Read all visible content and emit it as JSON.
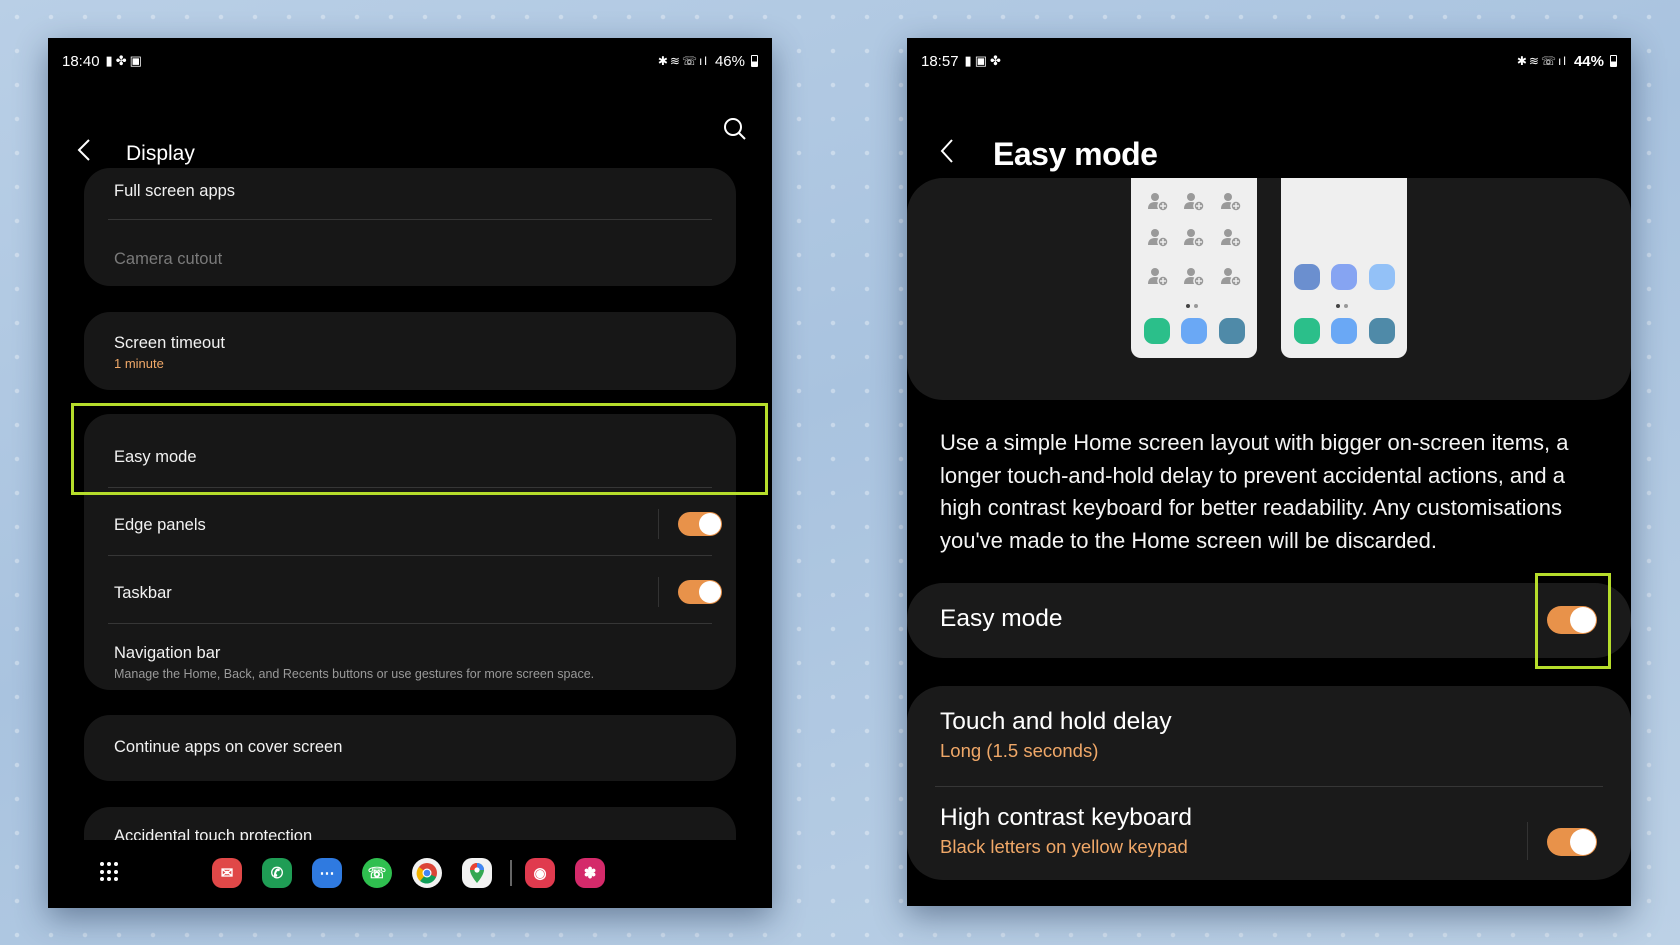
{
  "left_screen": {
    "status_bar": {
      "time": "18:40",
      "notification_icons": [
        "phone-icon",
        "fan-icon",
        "image-icon"
      ],
      "system_icons": [
        "bluetooth-icon",
        "wifi-icon",
        "wifi-calling-icon",
        "signal-icon"
      ],
      "battery": "46%"
    },
    "header": {
      "title": "Display",
      "back_icon": "chevron-left-icon",
      "search_icon": "search-icon"
    },
    "groups": [
      {
        "items": [
          {
            "label": "Full screen apps"
          },
          {
            "label": "Camera cutout",
            "disabled": true
          }
        ]
      },
      {
        "items": [
          {
            "label": "Screen timeout",
            "value": "1 minute"
          }
        ]
      },
      {
        "items": [
          {
            "label": "Easy mode",
            "highlighted": true
          },
          {
            "label": "Edge panels",
            "toggle": true
          },
          {
            "label": "Taskbar",
            "toggle": true
          },
          {
            "label": "Navigation bar",
            "description": "Manage the Home, Back, and Recents buttons or use gestures for more screen space."
          }
        ]
      },
      {
        "items": [
          {
            "label": "Continue apps on cover screen"
          }
        ]
      },
      {
        "items": [
          {
            "label": "Accidental touch protection",
            "toggle": true
          }
        ]
      }
    ],
    "dock": {
      "apps": [
        {
          "name": "Email",
          "icon": "email-icon",
          "color": "#e04848"
        },
        {
          "name": "Phone",
          "icon": "phone-icon",
          "color": "#1f9d55"
        },
        {
          "name": "Messages",
          "icon": "messages-icon",
          "color": "#2f7ae0"
        },
        {
          "name": "WhatsApp",
          "icon": "whatsapp-icon",
          "color": "#2fbf4f"
        },
        {
          "name": "Chrome",
          "icon": "chrome-icon",
          "color": "#f2f2f2"
        },
        {
          "name": "Maps",
          "icon": "maps-icon",
          "color": "#f2f2f2"
        },
        {
          "name": "Camera",
          "icon": "camera-icon",
          "color": "#e03a4e"
        },
        {
          "name": "Bixby",
          "icon": "flower-icon",
          "color": "#d42a6a"
        }
      ]
    }
  },
  "right_screen": {
    "status_bar": {
      "time": "18:57",
      "notification_icons": [
        "phone-icon",
        "image-icon",
        "fan-icon"
      ],
      "system_icons": [
        "bluetooth-icon",
        "wifi-icon",
        "wifi-calling-icon",
        "signal-icon"
      ],
      "battery": "44%"
    },
    "header": {
      "title": "Easy mode",
      "back_icon": "chevron-left-icon"
    },
    "description": "Use a simple Home screen layout with bigger on-screen items, a longer touch-and-hold delay to prevent accidental actions, and a high contrast keyboard for better readability. Any customisations you've made to the Home screen will be discarded.",
    "main_toggle": {
      "label": "Easy mode",
      "on": true,
      "highlighted": true
    },
    "settings": [
      {
        "label": "Touch and hold delay",
        "value": "Long (1.5 seconds)"
      },
      {
        "label": "High contrast keyboard",
        "value": "Black letters on yellow keypad",
        "toggle": true,
        "on": true
      }
    ],
    "preview": {
      "colors": {
        "green": "#2bbf8a",
        "light_blue": "#6aa8f5",
        "teal": "#4f8aa8",
        "blue1": "#6b8fcf",
        "blue2": "#86a4f2",
        "blue3": "#93c1f7"
      }
    }
  },
  "accent_colors": {
    "toggle_on": "#e8924a",
    "subtext_orange": "#f0a868",
    "highlight_box": "#b6dd2b"
  }
}
